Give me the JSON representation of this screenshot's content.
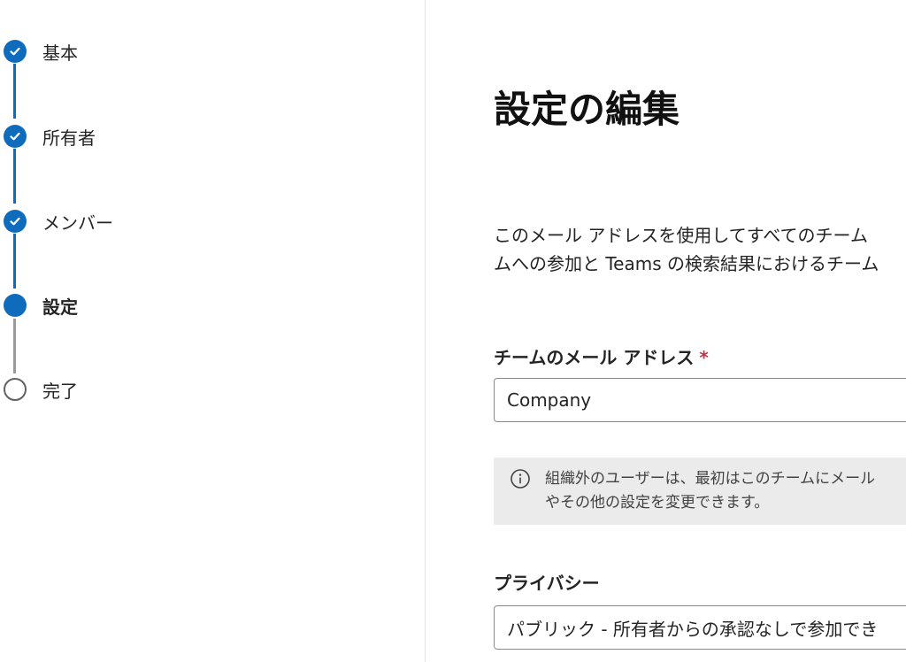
{
  "stepper": {
    "steps": [
      {
        "label": "基本",
        "state": "done"
      },
      {
        "label": "所有者",
        "state": "done"
      },
      {
        "label": "メンバー",
        "state": "done"
      },
      {
        "label": "設定",
        "state": "current"
      },
      {
        "label": "完了",
        "state": "todo"
      }
    ]
  },
  "main": {
    "title": "設定の編集",
    "description": {
      "line1": "このメール アドレスを使用してすべてのチーム",
      "line2": "ムへの参加と Teams の検索結果におけるチーム"
    },
    "email_field": {
      "label": "チームのメール アドレス",
      "required_mark": "*",
      "value": "Company"
    },
    "info": {
      "line1": "組織外のユーザーは、最初はこのチームにメール",
      "line2": "やその他の設定を変更できます。"
    },
    "privacy_field": {
      "label": "プライバシー",
      "selected": "パブリック - 所有者からの承認なしで参加でき"
    }
  },
  "colors": {
    "accent": "#0f6cbd",
    "required": "#c4314b",
    "info_background": "#ebebeb"
  },
  "icons": {
    "done": "checkmark-icon",
    "info": "info-icon"
  }
}
